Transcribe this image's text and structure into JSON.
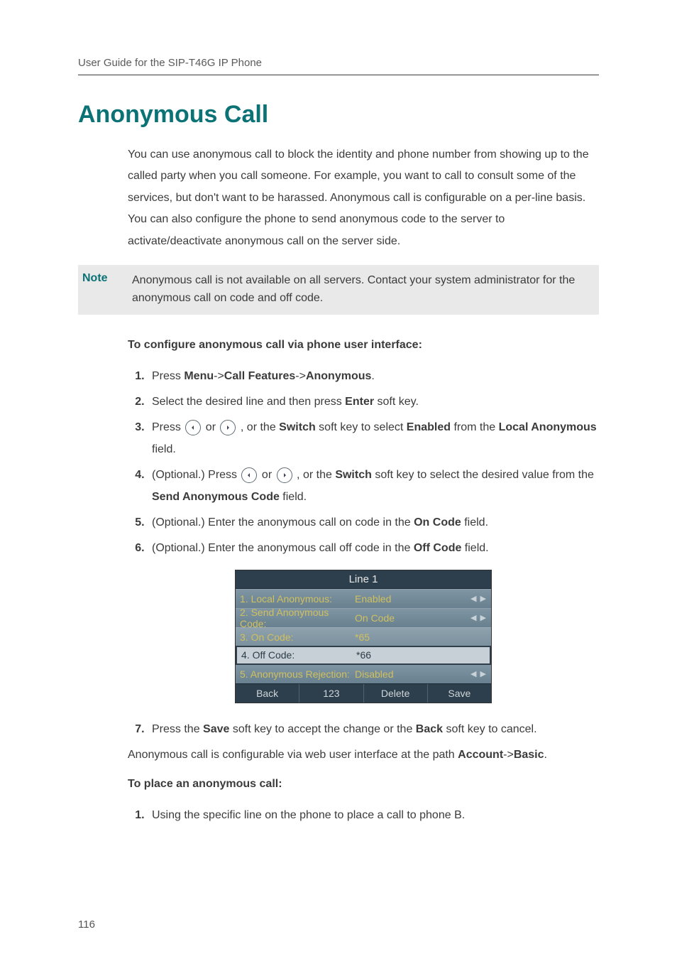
{
  "header": {
    "running_head": "User Guide for the SIP-T46G IP Phone"
  },
  "title": "Anonymous Call",
  "intro": "You can use anonymous call to block the identity and phone number from showing up to the called party when you call someone. For example, you want to call to consult some of the services, but don't want to be harassed. Anonymous call is configurable on a per-line basis. You can also configure the phone to send anonymous code to the server to activate/deactivate anonymous call on the server side.",
  "note": {
    "label": "Note",
    "text": "Anonymous call is not available on all servers. Contact your system administrator for the anonymous call on code and off code."
  },
  "config_heading": "To configure anonymous call via phone user interface:",
  "steps": {
    "s1a": "Press ",
    "s1b": "Menu",
    "s1c": "->",
    "s1d": "Call Features",
    "s1e": "->",
    "s1f": "Anonymous",
    "s1g": ".",
    "s2a": "Select the desired line and then press ",
    "s2b": "Enter",
    "s2c": " soft key.",
    "s3a": "Press ",
    "s3b": " or ",
    "s3c": " , or the ",
    "s3d": "Switch",
    "s3e": " soft key to select ",
    "s3f": "Enabled",
    "s3g": " from the ",
    "s3h": "Local Anonymous",
    "s3i": " field.",
    "s4a": "(Optional.) Press ",
    "s4b": " or ",
    "s4c": " , or the ",
    "s4d": "Switch",
    "s4e": " soft key to select the desired value from the ",
    "s4f": "Send Anonymous Code",
    "s4g": " field.",
    "s5a": "(Optional.) Enter the anonymous call on code in the ",
    "s5b": "On Code",
    "s5c": " field.",
    "s6a": "(Optional.) Enter the anonymous call off code in the ",
    "s6b": "Off Code",
    "s6c": " field.",
    "s7a": "Press the ",
    "s7b": "Save",
    "s7c": " soft key to accept the change or the ",
    "s7d": "Back",
    "s7e": " soft key to cancel."
  },
  "screen": {
    "title": "Line 1",
    "rows": [
      {
        "label": "1. Local Anonymous:",
        "value": "Enabled",
        "arrows": true
      },
      {
        "label": "2. Send Anonymous Code:",
        "value": "On Code",
        "arrows": true
      },
      {
        "label": "3. On Code:",
        "value": "*65",
        "arrows": false
      },
      {
        "label": "4. Off Code:",
        "value": "*66",
        "arrows": false
      },
      {
        "label": "5. Anonymous Rejection:",
        "value": "Disabled",
        "arrows": true
      }
    ],
    "softkeys": [
      "Back",
      "123",
      "Delete",
      "Save"
    ],
    "arrow_glyph": "◀ ▶"
  },
  "after": {
    "web_a": "Anonymous call is configurable via web user interface at the path ",
    "web_b": "Account",
    "web_c": "->",
    "web_d": "Basic",
    "web_e": "."
  },
  "place_heading": "To place an anonymous call:",
  "place_steps": {
    "p1": "Using the specific line on the phone to place a call to phone B."
  },
  "page_number": "116"
}
